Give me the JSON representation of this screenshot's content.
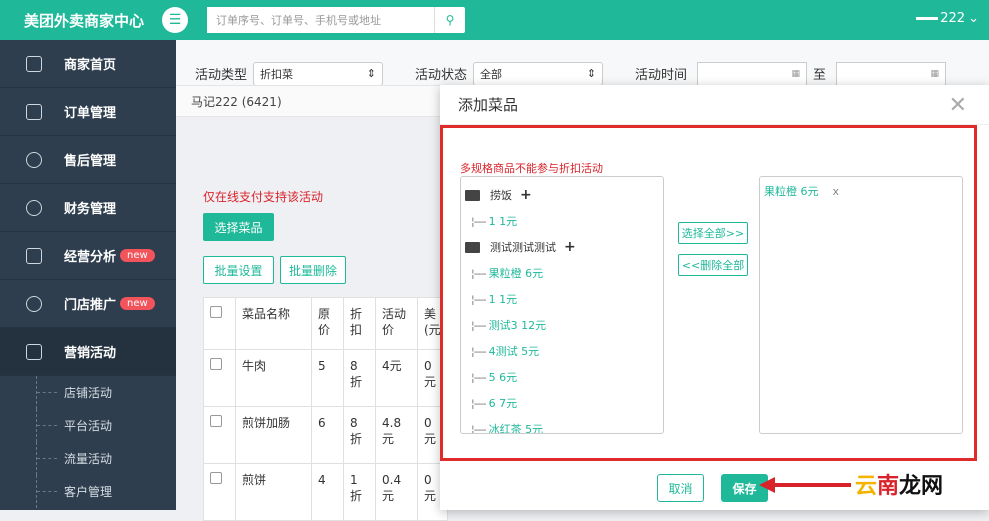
{
  "topbar": {
    "brand": "美团外卖商家中心",
    "search_placeholder": "订单序号、订单号、手机号或地址",
    "user_name": "222"
  },
  "sidebar": {
    "items": [
      {
        "label": "商家首页",
        "icon": "home-icon"
      },
      {
        "label": "订单管理",
        "icon": "order-icon"
      },
      {
        "label": "售后管理",
        "icon": "yen-icon"
      },
      {
        "label": "财务管理",
        "icon": "finance-icon"
      },
      {
        "label": "经营分析",
        "icon": "chart-icon",
        "badge": "new"
      },
      {
        "label": "门店推广",
        "icon": "promo-icon",
        "badge": "new"
      },
      {
        "label": "营销活动",
        "icon": "gift-icon"
      }
    ],
    "sub_items": [
      "店铺活动",
      "平台活动",
      "流量活动",
      "客户管理"
    ]
  },
  "filter": {
    "type_label": "活动类型",
    "type_value": "折扣菜",
    "status_label": "活动状态",
    "status_value": "全部",
    "time_label": "活动时间",
    "to_label": "至"
  },
  "shop": {
    "name": "马记222 (6421)"
  },
  "page": {
    "only_online_pay": "仅在线支付支持该活动",
    "choose_dish_btn": "选择菜品",
    "batch_set_btn": "批量设置",
    "batch_delete_btn": "批量删除"
  },
  "table": {
    "headers": [
      "菜品名称",
      "原价",
      "折扣",
      "活动价",
      "美(元"
    ],
    "rows": [
      {
        "name": "牛肉",
        "price": "5",
        "discount": "8折",
        "act_price": "4元",
        "extra": "0元"
      },
      {
        "name": "煎饼加肠",
        "price": "6",
        "discount": "8折",
        "act_price": "4.8元",
        "extra": "0元"
      },
      {
        "name": "煎饼",
        "price": "4",
        "discount": "1折",
        "act_price": "0.4元",
        "extra": "0元"
      }
    ]
  },
  "modal": {
    "title": "添加菜品",
    "warning": "多规格商品不能参与折扣活动",
    "tree": [
      {
        "group": "捞饭",
        "items": [
          "1 1元"
        ]
      },
      {
        "group": "测试测试测试",
        "items": [
          "果粒橙 6元",
          "1 1元",
          "测试3 12元",
          "4测试 5元",
          "5 6元",
          "6 7元",
          "冰红茶 5元",
          "...."
        ]
      }
    ],
    "select_all_btn": "选择全部>>",
    "delete_all_btn": "<<删除全部",
    "selected": [
      {
        "name": "果粒橙 6元",
        "remove": "x"
      }
    ],
    "cancel_btn": "取消",
    "save_btn": "保存"
  },
  "watermark": {
    "part1": "云",
    "part2": "南",
    "part3": "龙网"
  },
  "colors": {
    "accent": "#1fb99a",
    "sidebar": "#2e3e4e",
    "danger": "#d9232a",
    "badge": "#f2545b"
  }
}
